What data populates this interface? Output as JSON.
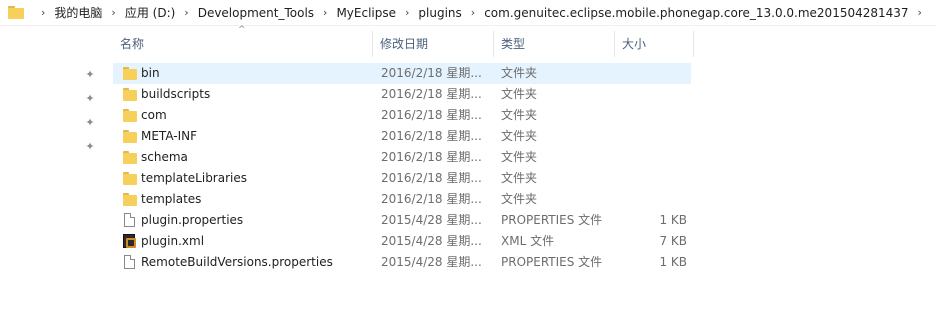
{
  "address_bar": {
    "crumbs": [
      "我的电脑",
      "应用 (D:)",
      "Development_Tools",
      "MyEclipse",
      "plugins",
      "com.genuitec.eclipse.mobile.phonegap.core_13.0.0.me201504281437"
    ]
  },
  "columns": {
    "name": "名称",
    "date": "修改日期",
    "type": "类型",
    "size": "大小"
  },
  "files": [
    {
      "name": "bin",
      "date": "2016/2/18 星期...",
      "type": "文件夹",
      "size": "",
      "icon": "folder-icon"
    },
    {
      "name": "buildscripts",
      "date": "2016/2/18 星期...",
      "type": "文件夹",
      "size": "",
      "icon": "folder-icon"
    },
    {
      "name": "com",
      "date": "2016/2/18 星期...",
      "type": "文件夹",
      "size": "",
      "icon": "folder-icon"
    },
    {
      "name": "META-INF",
      "date": "2016/2/18 星期...",
      "type": "文件夹",
      "size": "",
      "icon": "folder-icon"
    },
    {
      "name": "schema",
      "date": "2016/2/18 星期...",
      "type": "文件夹",
      "size": "",
      "icon": "folder-icon"
    },
    {
      "name": "templateLibraries",
      "date": "2016/2/18 星期...",
      "type": "文件夹",
      "size": "",
      "icon": "folder-icon"
    },
    {
      "name": "templates",
      "date": "2016/2/18 星期...",
      "type": "文件夹",
      "size": "",
      "icon": "folder-icon"
    },
    {
      "name": "plugin.properties",
      "date": "2015/4/28 星期...",
      "type": "PROPERTIES 文件",
      "size": "1 KB",
      "icon": "document-icon"
    },
    {
      "name": "plugin.xml",
      "date": "2015/4/28 星期...",
      "type": "XML 文件",
      "size": "7 KB",
      "icon": "xml-file-icon"
    },
    {
      "name": "RemoteBuildVersions.properties",
      "date": "2015/4/28 星期...",
      "type": "PROPERTIES 文件",
      "size": "1 KB",
      "icon": "document-icon"
    }
  ],
  "colors": {
    "selection": "#e5f3ff",
    "folder": "#f7cf5b",
    "header_text": "#4c607a"
  }
}
